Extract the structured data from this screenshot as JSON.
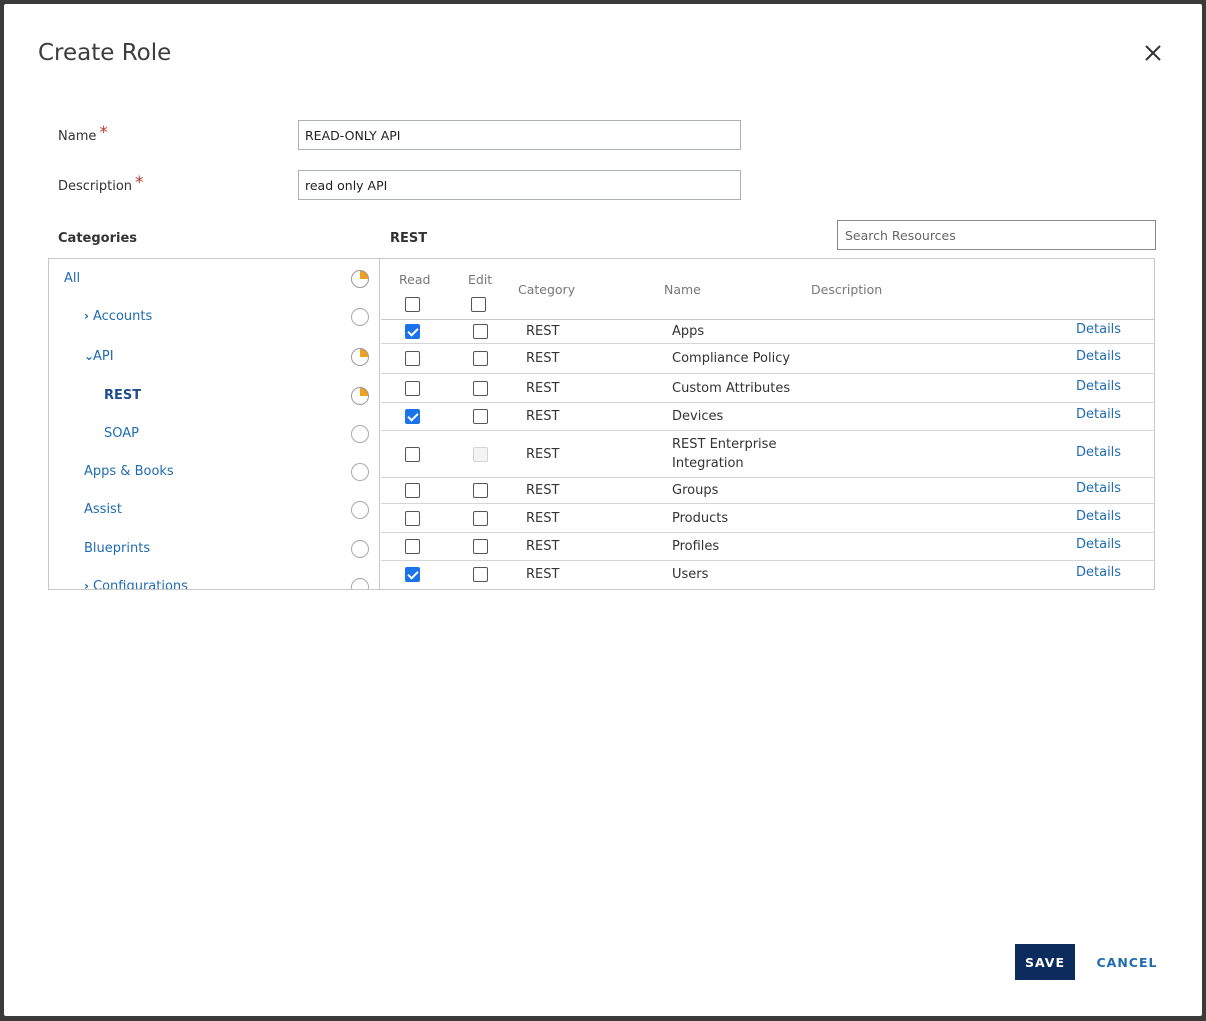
{
  "dialog": {
    "title": "Create Role",
    "close_icon": "close-icon"
  },
  "form": {
    "name_label": "Name",
    "name_value": "READ-ONLY API",
    "description_label": "Description",
    "description_value": "read only API",
    "required_mark": "*"
  },
  "categories": {
    "heading": "Categories",
    "items": [
      {
        "label": "All",
        "state": "partial",
        "chevron": ""
      },
      {
        "label": "Accounts",
        "state": "none",
        "chevron": "›"
      },
      {
        "label": "API",
        "state": "partial",
        "chevron": "⌄"
      },
      {
        "label": "REST",
        "state": "partial",
        "chevron": ""
      },
      {
        "label": "SOAP",
        "state": "none",
        "chevron": ""
      },
      {
        "label": "Apps & Books",
        "state": "none",
        "chevron": ""
      },
      {
        "label": "Assist",
        "state": "none",
        "chevron": ""
      },
      {
        "label": "Blueprints",
        "state": "none",
        "chevron": ""
      },
      {
        "label": "Configurations",
        "state": "none",
        "chevron": "›"
      }
    ]
  },
  "resources": {
    "heading": "REST",
    "search_placeholder": "Search Resources",
    "columns": {
      "read": "Read",
      "edit": "Edit",
      "category": "Category",
      "name": "Name",
      "description": "Description"
    },
    "details_label": "Details",
    "rows": [
      {
        "read": true,
        "edit": false,
        "edit_disabled": false,
        "category": "REST",
        "name": [
          "Apps"
        ]
      },
      {
        "read": false,
        "edit": false,
        "edit_disabled": false,
        "category": "REST",
        "name": [
          "Compliance Policy"
        ]
      },
      {
        "read": false,
        "edit": false,
        "edit_disabled": false,
        "category": "REST",
        "name": [
          "Custom Attributes"
        ]
      },
      {
        "read": true,
        "edit": false,
        "edit_disabled": false,
        "category": "REST",
        "name": [
          "Devices"
        ]
      },
      {
        "read": false,
        "edit": false,
        "edit_disabled": true,
        "category": "REST",
        "name": [
          "REST Enterprise",
          "Integration"
        ]
      },
      {
        "read": false,
        "edit": false,
        "edit_disabled": false,
        "category": "REST",
        "name": [
          "Groups"
        ]
      },
      {
        "read": false,
        "edit": false,
        "edit_disabled": false,
        "category": "REST",
        "name": [
          "Products"
        ]
      },
      {
        "read": false,
        "edit": false,
        "edit_disabled": false,
        "category": "REST",
        "name": [
          "Profiles"
        ]
      },
      {
        "read": true,
        "edit": false,
        "edit_disabled": false,
        "category": "REST",
        "name": [
          "Users"
        ]
      }
    ]
  },
  "footer": {
    "save_label": "SAVE",
    "cancel_label": "CANCEL"
  },
  "colors": {
    "accent": "#1f6cb0",
    "primary_button": "#0d2c5e",
    "partial_indicator": "#f0a020",
    "checkbox_checked": "#1a73e8"
  }
}
